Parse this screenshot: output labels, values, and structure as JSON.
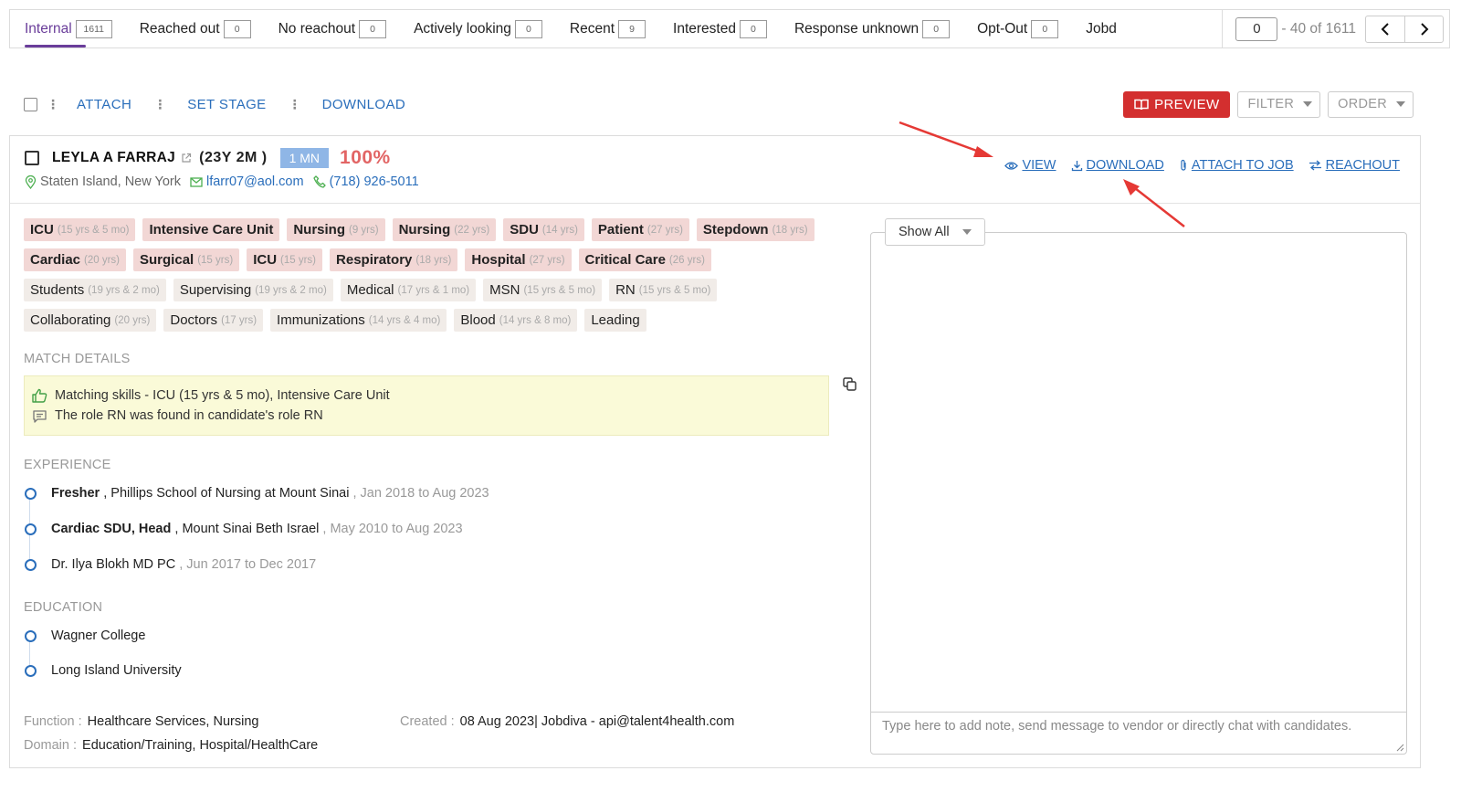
{
  "tabs": [
    {
      "label": "Internal",
      "count": "1611",
      "active": true
    },
    {
      "label": "Reached out",
      "count": "0"
    },
    {
      "label": "No reachout",
      "count": "0"
    },
    {
      "label": "Actively looking",
      "count": "0"
    },
    {
      "label": "Recent",
      "count": "9"
    },
    {
      "label": "Interested",
      "count": "0"
    },
    {
      "label": "Response unknown",
      "count": "0"
    },
    {
      "label": "Opt-Out",
      "count": "0"
    },
    {
      "label": "Jobd",
      "count": null
    }
  ],
  "pager": {
    "page_value": "0",
    "range": "- 40 of 1611"
  },
  "toolbar": {
    "attach": "ATTACH",
    "set_stage": "SET STAGE",
    "download": "DOWNLOAD",
    "preview": "PREVIEW",
    "filter": "FILTER",
    "order": "ORDER"
  },
  "candidate": {
    "name": "LEYLA A FARRAJ",
    "age": "(23Y 2M )",
    "badge": "1 MN",
    "score": "100%",
    "location": "Staten Island, New York",
    "email": "lfarr07@aol.com",
    "phone": "(718) 926-5011",
    "actions": {
      "view": "VIEW",
      "download": "DOWNLOAD",
      "attach": "ATTACH TO JOB",
      "reachout": "REACHOUT"
    },
    "skills": [
      {
        "name": "ICU",
        "dur": "(15 yrs & 5 mo)",
        "hl": true
      },
      {
        "name": "Intensive Care Unit",
        "dur": "",
        "hl": true
      },
      {
        "name": "Nursing",
        "dur": "(9 yrs)",
        "hl": true
      },
      {
        "name": "Nursing",
        "dur": "(22 yrs)",
        "hl": true
      },
      {
        "name": "SDU",
        "dur": "(14 yrs)",
        "hl": true
      },
      {
        "name": "Patient",
        "dur": "(27 yrs)",
        "hl": true
      },
      {
        "name": "Stepdown",
        "dur": "(18 yrs)",
        "hl": true
      },
      {
        "name": "Cardiac",
        "dur": "(20 yrs)",
        "hl": true
      },
      {
        "name": "Surgical",
        "dur": "(15 yrs)",
        "hl": true
      },
      {
        "name": "ICU",
        "dur": "(15 yrs)",
        "hl": true
      },
      {
        "name": "Respiratory",
        "dur": "(18 yrs)",
        "hl": true
      },
      {
        "name": "Hospital",
        "dur": "(27 yrs)",
        "hl": true
      },
      {
        "name": "Critical Care",
        "dur": "(26 yrs)",
        "hl": true
      },
      {
        "name": "Students",
        "dur": "(19 yrs & 2 mo)",
        "hl": false
      },
      {
        "name": "Supervising",
        "dur": "(19 yrs & 2 mo)",
        "hl": false
      },
      {
        "name": "Medical",
        "dur": "(17 yrs & 1 mo)",
        "hl": false
      },
      {
        "name": "MSN",
        "dur": "(15 yrs & 5 mo)",
        "hl": false
      },
      {
        "name": "RN",
        "dur": "(15 yrs & 5 mo)",
        "hl": false
      },
      {
        "name": "Collaborating",
        "dur": "(20 yrs)",
        "hl": false
      },
      {
        "name": "Doctors",
        "dur": "(17 yrs)",
        "hl": false
      },
      {
        "name": "Immunizations",
        "dur": "(14 yrs & 4 mo)",
        "hl": false
      },
      {
        "name": "Blood",
        "dur": "(14 yrs & 8 mo)",
        "hl": false
      },
      {
        "name": "Leading",
        "dur": "",
        "hl": false
      }
    ],
    "match_label": "MATCH DETAILS",
    "match": {
      "skills_line": "Matching skills - ICU (15 yrs & 5 mo), Intensive Care Unit",
      "role_line": "The role RN was found in candidate's role RN"
    },
    "experience_label": "EXPERIENCE",
    "experience": [
      {
        "role": "Fresher",
        "org": " , Phillips School of Nursing at Mount Sinai",
        "date": " , Jan 2018 to Aug 2023"
      },
      {
        "role": "Cardiac SDU, Head",
        "org": " , Mount Sinai Beth Israel",
        "date": " , May 2010 to Aug 2023"
      },
      {
        "role": "",
        "org": "Dr. Ilya Blokh MD PC",
        "date": " , Jun 2017 to Dec 2017"
      }
    ],
    "education_label": "EDUCATION",
    "education": [
      "Wagner College",
      "Long Island University"
    ],
    "function_label": "Function :",
    "function": "Healthcare Services, Nursing",
    "domain_label": "Domain :",
    "domain": "Education/Training, Hospital/HealthCare",
    "created_label": "Created :",
    "created": "08 Aug 2023| Jobdiva - api@talent4health.com"
  },
  "notes": {
    "filter": "Show All",
    "placeholder": "Type here to add note, send message to vendor or directly chat with candidates."
  },
  "colors": {
    "accent": "#2a6ebb",
    "tab_active": "#6a3d9a",
    "preview": "#d32f2f",
    "score": "#e26565",
    "chip_hl": "#f2d7d5"
  }
}
